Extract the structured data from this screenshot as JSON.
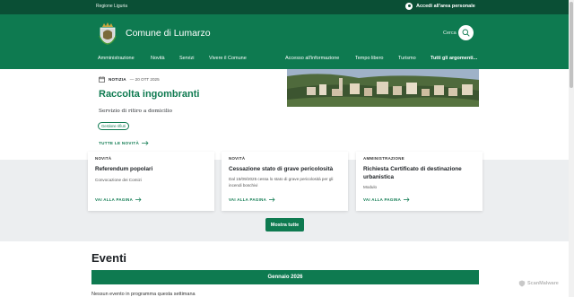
{
  "topbar": {
    "region": "Regione Liguria",
    "login_label": "Accedi all'area personale"
  },
  "header": {
    "site_title": "Comune di Lumarzo",
    "search_label": "Cerca"
  },
  "nav": {
    "items": [
      "Amministrazione",
      "Novità",
      "Servizi",
      "Vivere il Comune",
      "Accesso all'informazione",
      "Tempo libero",
      "Turismo",
      "Tutti gli argomenti..."
    ]
  },
  "hero": {
    "kind": "NOTIZIA",
    "date": "— 20 OTT 2025",
    "title": "Raccolta ingombranti",
    "subtitle": "Servizio di ritiro a domicilio",
    "tag": "Gestione rifiuti",
    "link": "TUTTE LE NOVITÀ"
  },
  "cards": [
    {
      "category": "NOVITÀ",
      "title": "Referendum popolari",
      "description": "Convocazione dei Comizi",
      "link": "VAI ALLA PAGINA"
    },
    {
      "category": "NOVITÀ",
      "title": "Cessazione stato di grave pericolosità",
      "description": "Dal 15/09/2025 cessa lo stato di grave pericolosità per gli incendi boschivi",
      "link": "VAI ALLA PAGINA"
    },
    {
      "category": "AMMINISTRAZIONE",
      "title": "Richiesta Certificato di destinazione urbanistica",
      "description": "Modulo",
      "link": "VAI ALLA PAGINA"
    }
  ],
  "more_button": "Mostra tutte",
  "events": {
    "title": "Eventi",
    "month": "Gennaio 2026",
    "empty_note": "Nessun evento in programma questa settimana"
  },
  "watermark": "ScanMalware",
  "colors": {
    "brand_green": "#0e7a50",
    "topbar_green": "#0a4f35",
    "band_gray": "#eceef0"
  }
}
